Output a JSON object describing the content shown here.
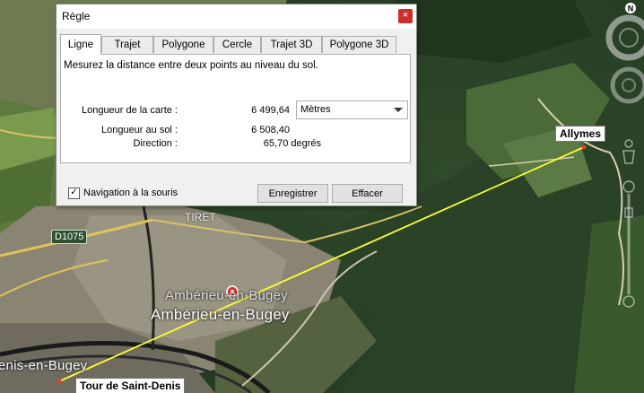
{
  "map": {
    "ghost_top_label": "...",
    "district_label": "TIRET",
    "road_label": "D1075",
    "town_label_ghost": "Ambérieu-en-Bugey",
    "town_label_main": "Ambérieu-en-Bugey",
    "town_label_left": "enis-en-Bugey",
    "pin_allymes": "Allymes",
    "pin_tour": "Tour de Saint-Denis",
    "compass_letter": "N",
    "measure_line_color": "#ffff33"
  },
  "dialog": {
    "title": "Règle",
    "close_glyph": "×",
    "tabs": [
      "Ligne",
      "Trajet",
      "Polygone",
      "Cercle",
      "Trajet 3D",
      "Polygone 3D"
    ],
    "active_tab": "Ligne",
    "description": "Mesurez la distance entre deux points au niveau du sol.",
    "map_length_label": "Longueur de la carte :",
    "map_length_value": "6 499,64",
    "unit_selected": "Mètres",
    "ground_length_label": "Longueur au sol :",
    "ground_length_value": "6 508,40",
    "direction_label": "Direction :",
    "direction_value": "65,70 degrés",
    "nav_checkbox_label": "Navigation à la souris",
    "nav_checkbox_checked": true,
    "nav_check_glyph": "✓",
    "save_button": "Enregistrer",
    "clear_button": "Effacer"
  }
}
